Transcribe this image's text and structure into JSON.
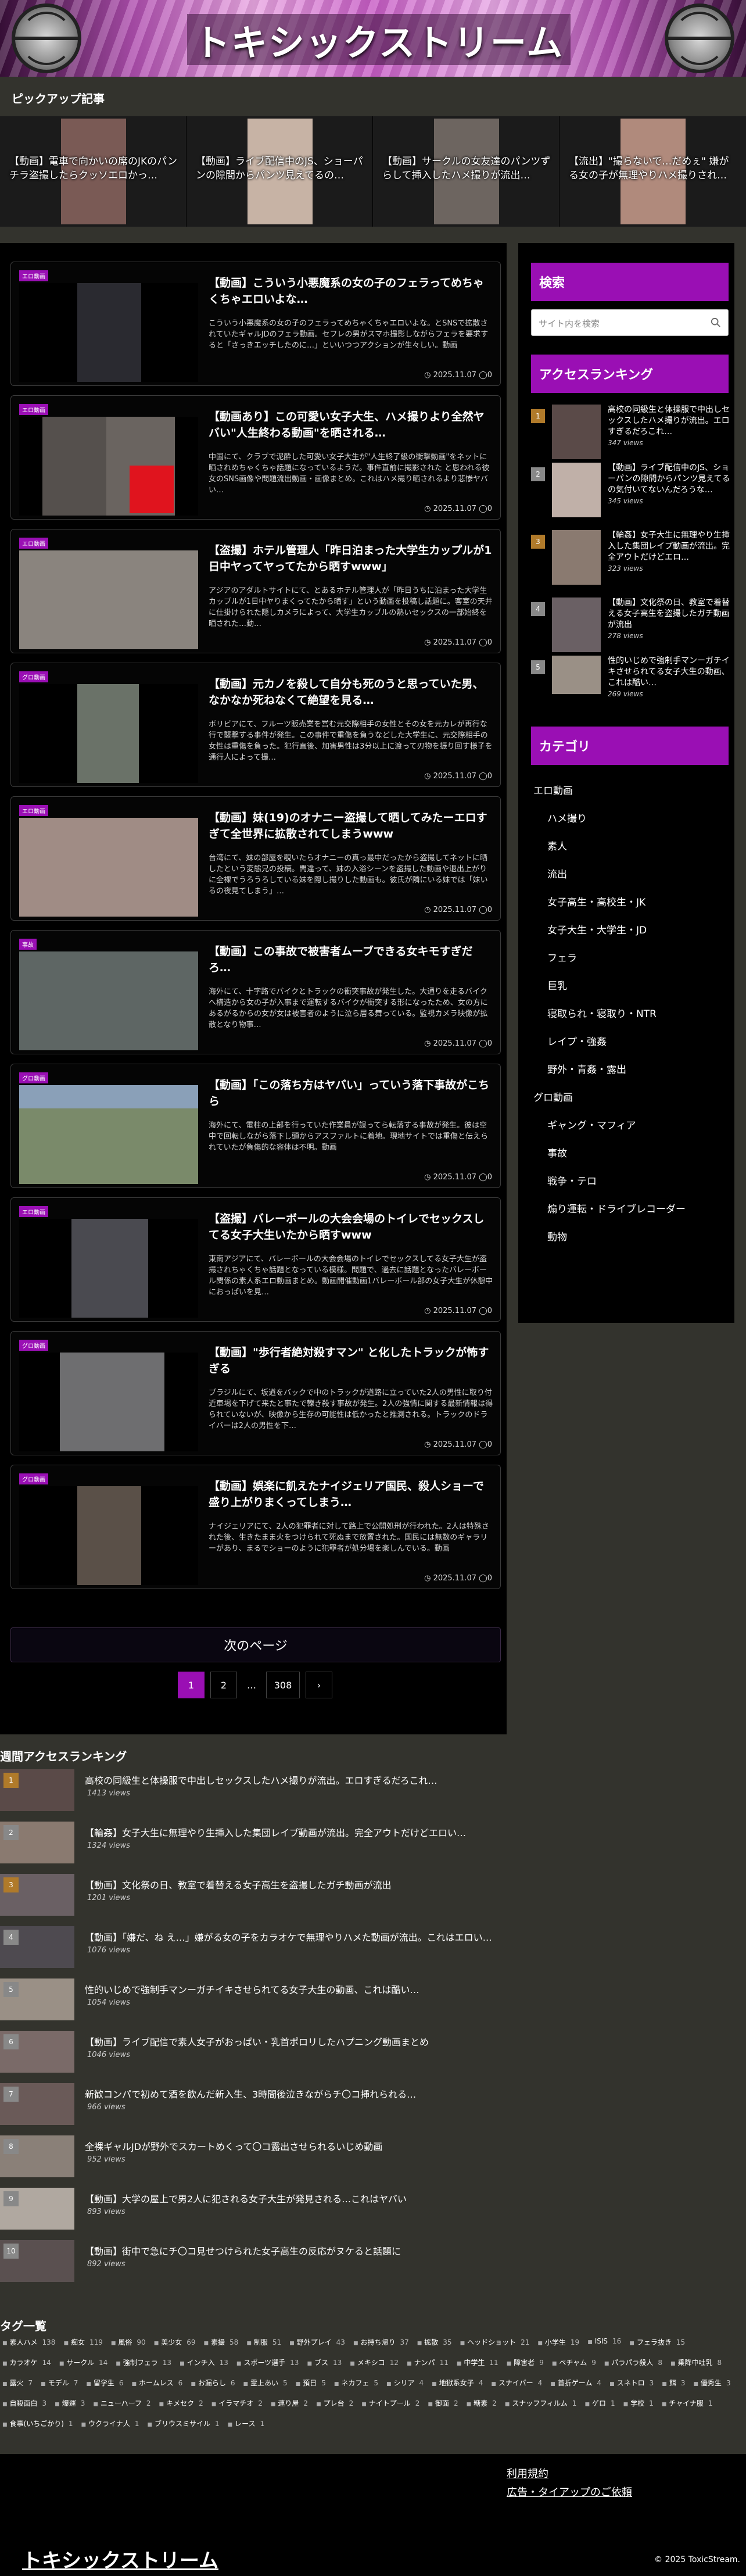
{
  "site": {
    "title": "トキシックストリーム"
  },
  "pickup": {
    "label": "ピックアップ記事",
    "items": [
      {
        "title": "【動画】電車で向かいの席のJKのパンチラ盗撮したらクッソエロかっ…",
        "color": "#7a5a55"
      },
      {
        "title": "【動画】ライブ配信中のJS、ショーパンの隙間からパンツ見えてるの…",
        "color": "#c7b3a5"
      },
      {
        "title": "【動画】サークルの女友達のパンツずらして挿入したハメ撮りが流出…",
        "color": "#6d6560"
      },
      {
        "title": "【流出】\"撮らないで…だめぇ\" 嫌がる女の子が無理やりハメ撮りされ…",
        "color": "#b08a7c"
      }
    ]
  },
  "posts": [
    {
      "badge": "エロ動画",
      "title": "【動画】こういう小悪魔系の女の子のフェラってめちゃくちゃエロいよな…",
      "excerpt": "こういう小悪魔系の女の子のフェラってめちゃくちゃエロいよな。とSNSで拡散されていたギャルJDのフェラ動画。セフレの男がスマホ撮影しながらフェラを要求すると「さっきエッチしたのに…」といいつつアクションが生々しい。動画",
      "date": "2025.11.07",
      "comments": "0",
      "color": "#2a2a30"
    },
    {
      "badge": "エロ動画",
      "title": "【動画あり】この可愛い女子大生、ハメ撮りより全然ヤバい\"人生終わる動画\"を晒される…",
      "excerpt": "中国にて、クラブで泥酔した可愛い女子大生が\"人生終了級の衝撃動画\"をネットに晒されめちゃくちゃ話題になっているようだ。事件直前に撮影された と思われる彼女のSNS画像や問題流出動画・画像まとめ。これはハメ撮り晒されるより悲惨ヤバい…",
      "date": "2025.11.07",
      "comments": "0",
      "color": "#55504d"
    },
    {
      "badge": "エロ動画",
      "title": "【盗撮】ホテル管理人「昨日泊まった大学生カップルが1日中ヤってヤってたから晒すwww」",
      "excerpt": "アジアのアダルトサイトにて、とあるホテル管理人が「昨日うちに泊まった大学生カップルが1日中ヤりまくってたから晒す」という動画を投稿し話題に。客室の天井に仕掛けられた隠しカメラによって、大学生カップルの熱いセックスの一部始終を晒された…動…",
      "date": "2025.11.07",
      "comments": "0",
      "color": "#8a847e"
    },
    {
      "badge": "グロ動画",
      "title": "【動画】元カノを殺して自分も死のうと思っていた男、なかなか死ねなくて絶望を見る…",
      "excerpt": "ボリビアにて、フルーツ販売業を営む元交際相手の女性とその女を元カレが再行な行で襲撃する事件が発生。この事件で重傷を負うなどした大学生に、元交際相手の女性は重傷を負った。犯行直後、加害男性は3分以上に渡って刃物を振り回す様子を通行人によって撮…",
      "date": "2025.11.07",
      "comments": "0",
      "color": "#6a7268"
    },
    {
      "badge": "エロ動画",
      "title": "【動画】妹(19)のオナニー盗撮して晒してみたーエロすぎて全世界に拡散されてしまうwww",
      "excerpt": "台湾にて、妹の部屋を覗いたらオナニーの真っ最中だったから盗撮してネットに晒したという変態兄の投稿。間違って、妹の入浴シーンを盗撮した動画や退出上がりに全裸でうろうろしている妹を隠し撮りした動画も。彼氏が隣にいる妹では「妹いるの夜見てしまう」…",
      "date": "2025.11.07",
      "comments": "0",
      "color": "#a08c85"
    },
    {
      "badge": "事故",
      "title": "【動画】この事故で被害者ムーブできる女キモすぎだろ…",
      "excerpt": "海外にて、十字路でバイクとトラックの衝突事故が発生した。大通りを走るバイクへ構造から女の子が入事まで運転するバイクが衝突する形になったため、女の方にあるがるからの女が女は被害者のように泣ら居る舞っている。監視カメラ映像が拡散となり物事…",
      "date": "2025.11.07",
      "comments": "0",
      "color": "#5e6664"
    },
    {
      "badge": "グロ動画",
      "title": "【動画】「この落ち方はヤバい」っていう落下事故がこちら",
      "excerpt": "海外にて、電柱の上部を行っていた作業員が誤ってら転落する事故が発生。彼は空中で回転しながら落下し頭からアスファルトに着地。現地サイトでは重傷と伝えられていたが負傷的な容体は不明。動画",
      "date": "2025.11.07",
      "comments": "0",
      "color": "#7a8a6a"
    },
    {
      "badge": "エロ動画",
      "title": "【盗撮】バレーボールの大会会場のトイレでセックスしてる女子大生いたから晒すwww",
      "excerpt": "東南アジアにて、バレーボールの大会会場のトイレでセックスしてる女子大生が盗撮されちゃくちゃ話題となっている模様。問題で、過去に話題となったバレーボール関係の素人系エロ動画まとめ。動画開催動画1バレーボール部の女子大生が休憩中におっぱいを見…",
      "date": "2025.11.07",
      "comments": "0",
      "color": "#4a4a50"
    },
    {
      "badge": "グロ動画",
      "title": "【動画】\"歩行者絶対殺すマン\" と化したトラックが怖すぎる",
      "excerpt": "ブラジルにて、坂道をバックで中のトラックが道路に立っていた2人の男性に取り付近車場を下げて来たと事たで轢き殺す事故が発生。2人の強情に関する最新情報は得られていないが、映像から生存の可能性は低かったと推測される。トラックのドライバーは2人の男性を下…",
      "date": "2025.11.07",
      "comments": "0",
      "color": "#6e6e70"
    },
    {
      "badge": "グロ動画",
      "title": "【動画】娯楽に飢えたナイジェリア国民、殺人ショーで盛り上がりまくってしまう…",
      "excerpt": "ナイジェリアにて、2人の犯罪者に対して路上で公開処刑が行われた。2人は特殊された後、生きたまま火をつけられて死ぬまで放置された。国民には無数のギャラリーがあり、まるでショーのように犯罪者が処分場を楽しんでいる。動画",
      "date": "2025.11.07",
      "comments": "0",
      "color": "#5a5048"
    }
  ],
  "pagination": {
    "next_label": "次のページ",
    "pages": [
      "1",
      "2",
      "…",
      "308",
      "›"
    ]
  },
  "sidebar": {
    "search_title": "検索",
    "search_placeholder": "サイト内を検索",
    "ranking_title": "アクセスランキング",
    "ranking": [
      {
        "num": "1",
        "title": "高校の同級生と体操服で中出しセックスしたハメ撮りが流出。エロすぎるだろこれ…",
        "views": "347 views",
        "color": "#5a4a48"
      },
      {
        "num": "2",
        "title": "【動画】ライブ配信中のJS、ショーパンの隙間からパンツ見えてるの気付いてないんだろうな…",
        "views": "345 views",
        "color": "#c0b0a8"
      },
      {
        "num": "3",
        "title": "【輪姦】女子大生に無理やり生挿入した集団レイプ動画が流出。完全アウトだけどエロ…",
        "views": "323 views",
        "color": "#8a7a70"
      },
      {
        "num": "4",
        "title": "【動画】文化祭の日、教室で着替える女子高生を盗撮したガチ動画が流出",
        "views": "278 views",
        "color": "#6a6064"
      },
      {
        "num": "5",
        "title": "性的いじめで強制手マンーガチイキさせられてる女子大生の動画、これは酷い…",
        "views": "269 views",
        "color": "#9a9086"
      }
    ],
    "category_title": "カテゴリ",
    "categories": [
      {
        "label": "エロ動画",
        "sub": false
      },
      {
        "label": "ハメ撮り",
        "sub": true
      },
      {
        "label": "素人",
        "sub": true
      },
      {
        "label": "流出",
        "sub": true
      },
      {
        "label": "女子高生・高校生・JK",
        "sub": true
      },
      {
        "label": "女子大生・大学生・JD",
        "sub": true
      },
      {
        "label": "フェラ",
        "sub": true
      },
      {
        "label": "巨乳",
        "sub": true
      },
      {
        "label": "寝取られ・寝取り・NTR",
        "sub": true
      },
      {
        "label": "レイプ・強姦",
        "sub": true
      },
      {
        "label": "野外・青姦・露出",
        "sub": true
      },
      {
        "label": "グロ動画",
        "sub": false
      },
      {
        "label": "ギャング・マフィア",
        "sub": true
      },
      {
        "label": "事故",
        "sub": true
      },
      {
        "label": "戦争・テロ",
        "sub": true
      },
      {
        "label": "煽り運転・ドライブレコーダー",
        "sub": true
      },
      {
        "label": "動物",
        "sub": true
      }
    ]
  },
  "weekly": {
    "title": "週間アクセスランキング",
    "items": [
      {
        "num": "1",
        "title": "高校の同級生と体操服で中出しセックスしたハメ撮りが流出。エロすぎるだろこれ…",
        "views": "1413 views",
        "color": "#5a4a48"
      },
      {
        "num": "2",
        "title": "【輪姦】女子大生に無理やり生挿入した集団レイプ動画が流出。完全アウトだけどエロい…",
        "views": "1324 views",
        "color": "#8a7a70"
      },
      {
        "num": "3",
        "title": "【動画】文化祭の日、教室で着替える女子高生を盗撮したガチ動画が流出",
        "views": "1201 views",
        "color": "#6a6064"
      },
      {
        "num": "4",
        "title": "【動画】「嫌だ、ね え…」嫌がる女の子をカラオケで無理やりハメた動画が流出。これはエロい…",
        "views": "1076 views",
        "color": "#4e4a50"
      },
      {
        "num": "5",
        "title": "性的いじめで強制手マンーガチイキさせられてる女子大生の動画、これは酷い…",
        "views": "1054 views",
        "color": "#9a9086"
      },
      {
        "num": "6",
        "title": "【動画】ライブ配信で素人女子がおっぱい・乳首ポロリしたハプニング動画まとめ",
        "views": "1046 views",
        "color": "#7a6a68"
      },
      {
        "num": "7",
        "title": "新歓コンパで初めて酒を飲んだ新入生、3時間後泣きながらチ〇コ挿れられる…",
        "views": "966 views",
        "color": "#6a5a58"
      },
      {
        "num": "8",
        "title": "全裸ギャルJDが野外でスカートめくって〇コ露出させられるいじめ動画",
        "views": "952 views",
        "color": "#8a8078"
      },
      {
        "num": "9",
        "title": "【動画】大学の屋上で男2人に犯される女子大生が発見される…これはヤバい",
        "views": "893 views",
        "color": "#b0a8a0"
      },
      {
        "num": "10",
        "title": "【動画】街中で急にチ〇コ見せつけられた女子高生の反応がヌケると話題に",
        "views": "892 views",
        "color": "#5a5050"
      }
    ]
  },
  "tags": {
    "title": "タグ一覧",
    "items": [
      {
        "label": "素人ハメ",
        "count": "138"
      },
      {
        "label": "痴女",
        "count": "119"
      },
      {
        "label": "風俗",
        "count": "90"
      },
      {
        "label": "美少女",
        "count": "69"
      },
      {
        "label": "素撮",
        "count": "58"
      },
      {
        "label": "制服",
        "count": "51"
      },
      {
        "label": "野外プレイ",
        "count": "43"
      },
      {
        "label": "お持ち帰り",
        "count": "37"
      },
      {
        "label": "拡散",
        "count": "35"
      },
      {
        "label": "ヘッドショット",
        "count": "21"
      },
      {
        "label": "小学生",
        "count": "19"
      },
      {
        "label": "ISIS",
        "count": "16"
      },
      {
        "label": "フェラ抜き",
        "count": "15"
      },
      {
        "label": "カラオケ",
        "count": "14"
      },
      {
        "label": "サークル",
        "count": "14"
      },
      {
        "label": "強制フェラ",
        "count": "13"
      },
      {
        "label": "インチ入",
        "count": "13"
      },
      {
        "label": "スポーツ選手",
        "count": "13"
      },
      {
        "label": "ブス",
        "count": "13"
      },
      {
        "label": "メキシコ",
        "count": "12"
      },
      {
        "label": "ナンパ",
        "count": "11"
      },
      {
        "label": "中学生",
        "count": "11"
      },
      {
        "label": "障害者",
        "count": "9"
      },
      {
        "label": "ペチャム",
        "count": "9"
      },
      {
        "label": "パラパラ殺人",
        "count": "8"
      },
      {
        "label": "乗降中吐乳",
        "count": "8"
      },
      {
        "label": "露火",
        "count": "7"
      },
      {
        "label": "モデル",
        "count": "7"
      },
      {
        "label": "留学生",
        "count": "6"
      },
      {
        "label": "ホームレス",
        "count": "6"
      },
      {
        "label": "お漏らし",
        "count": "6"
      },
      {
        "label": "霊上あい",
        "count": "5"
      },
      {
        "label": "預日",
        "count": "5"
      },
      {
        "label": "ネカフェ",
        "count": "5"
      },
      {
        "label": "シリア",
        "count": "4"
      },
      {
        "label": "地獄系女子",
        "count": "4"
      },
      {
        "label": "スナイパー",
        "count": "4"
      },
      {
        "label": "首折ゲーム",
        "count": "4"
      },
      {
        "label": "スネトロ",
        "count": "3"
      },
      {
        "label": "餌",
        "count": "3"
      },
      {
        "label": "優秀生",
        "count": "3"
      },
      {
        "label": "自殺面白",
        "count": "3"
      },
      {
        "label": "爆運",
        "count": "3"
      },
      {
        "label": "ニューハーフ",
        "count": "2"
      },
      {
        "label": "キメセク",
        "count": "2"
      },
      {
        "label": "イラマチオ",
        "count": "2"
      },
      {
        "label": "連り屋",
        "count": "2"
      },
      {
        "label": "プレ台",
        "count": "2"
      },
      {
        "label": "ナイトプール",
        "count": "2"
      },
      {
        "label": "御面",
        "count": "2"
      },
      {
        "label": "糖素",
        "count": "2"
      },
      {
        "label": "スナッフフィルム",
        "count": "1"
      },
      {
        "label": "ゲロ",
        "count": "1"
      },
      {
        "label": "学校",
        "count": "1"
      },
      {
        "label": "チャイナ服",
        "count": "1"
      },
      {
        "label": "食事(いちごかり)",
        "count": "1"
      },
      {
        "label": "ウクライナ人",
        "count": "1"
      },
      {
        "label": "ブリウスミサイル",
        "count": "1"
      },
      {
        "label": "レース",
        "count": "1"
      }
    ]
  },
  "footer": {
    "links": [
      "利用規約",
      "広告・タイアップのご依頼"
    ],
    "title": "トキシックストリーム",
    "copyright": "© 2025 ToxicStream."
  }
}
